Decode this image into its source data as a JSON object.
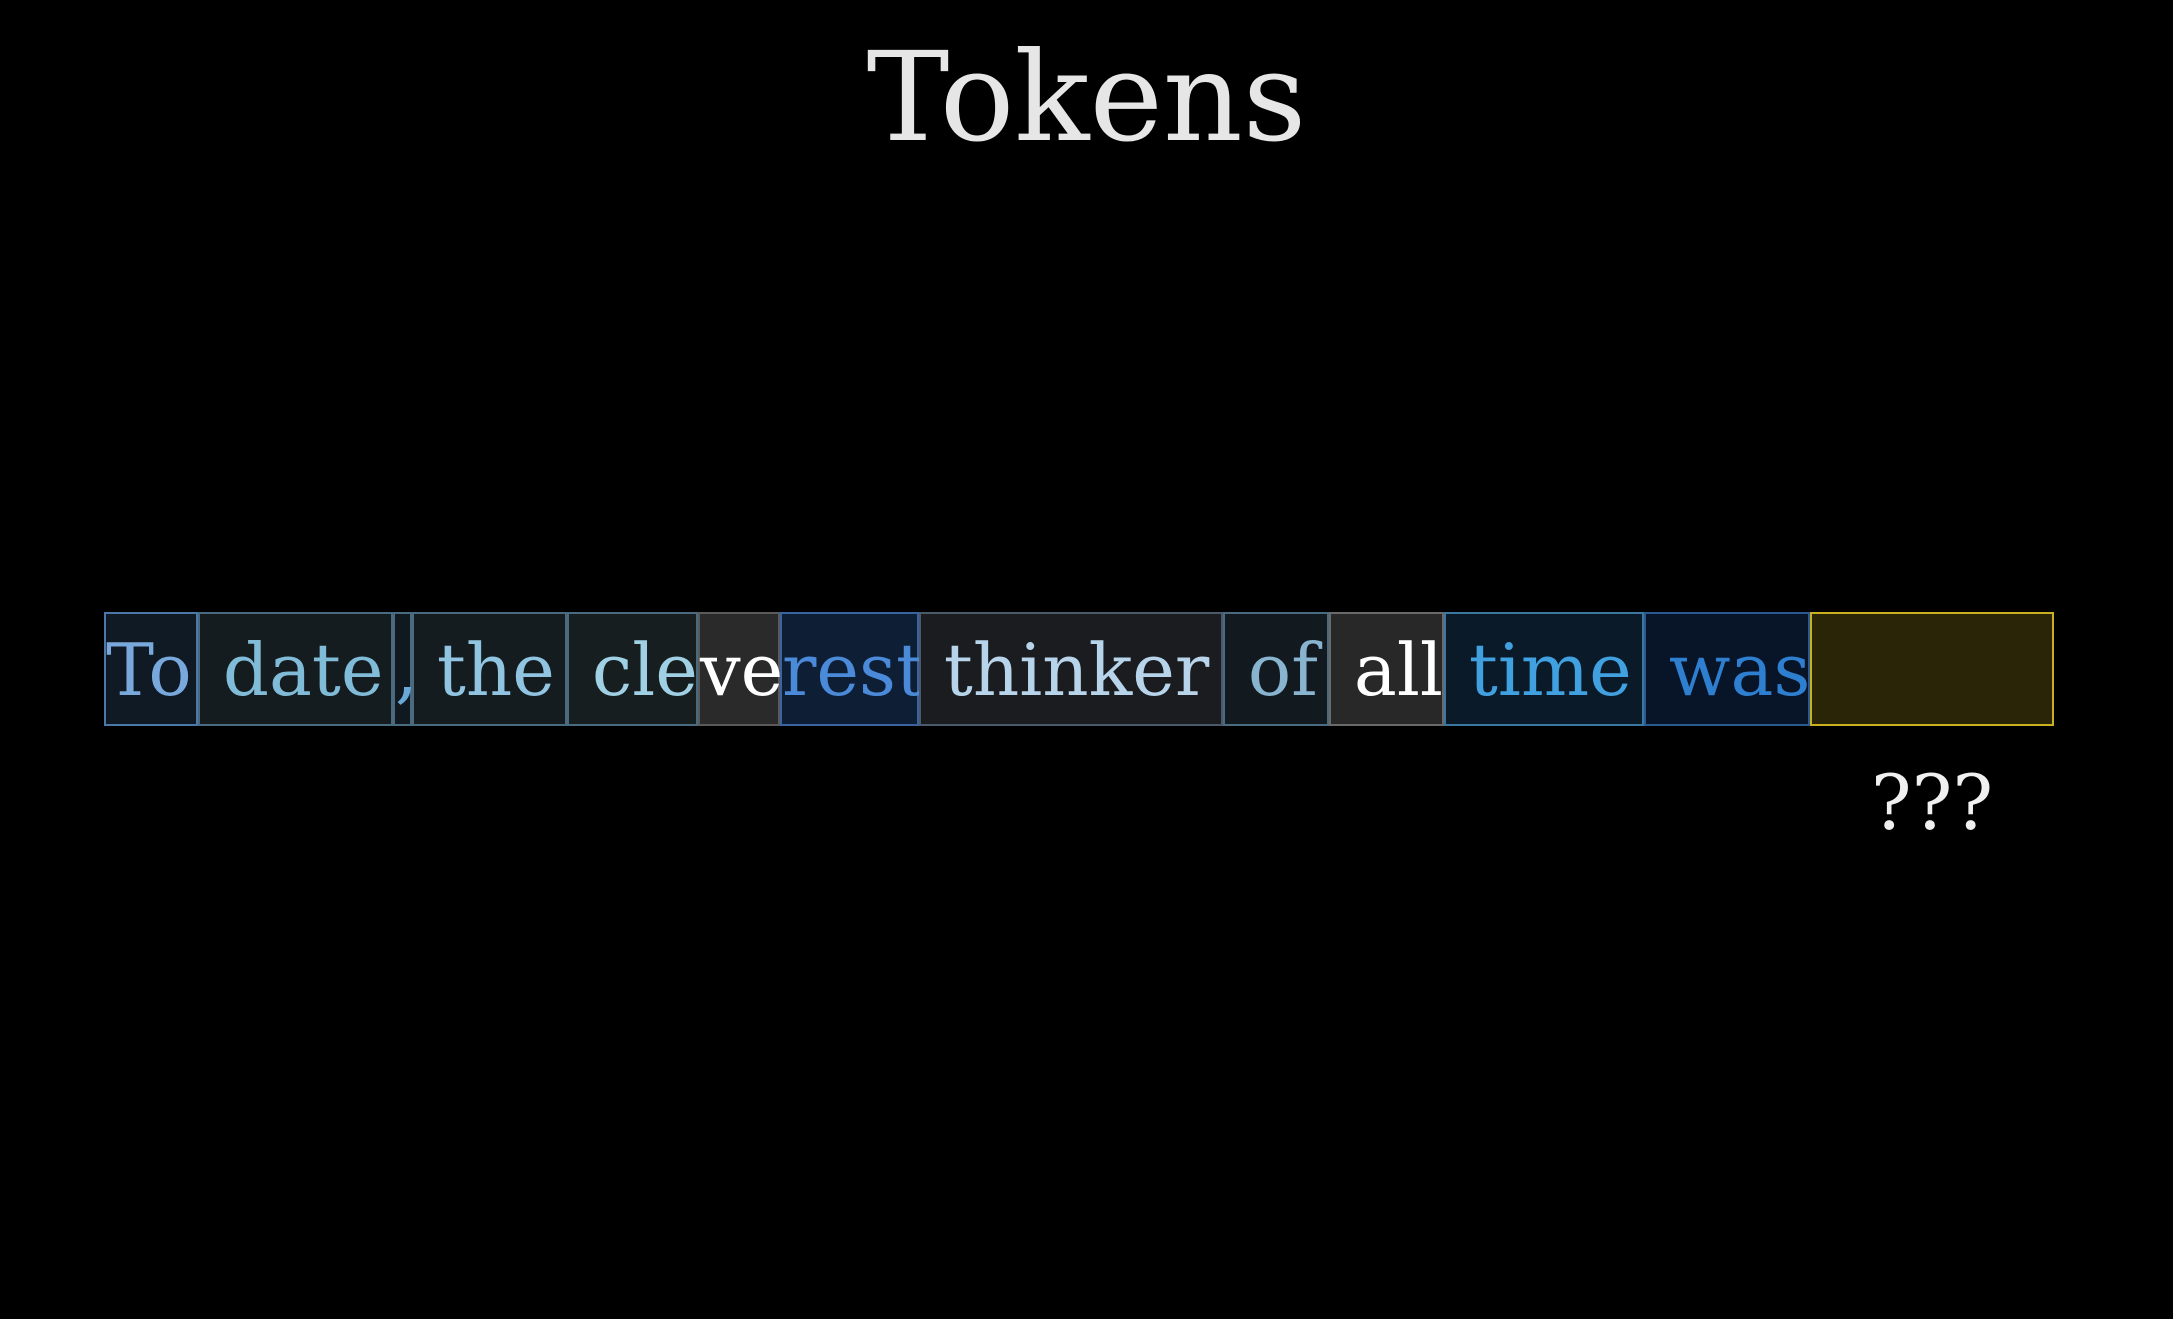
{
  "title": "Tokens",
  "tokens": [
    {
      "text": "To",
      "color": "#78a8dc",
      "fill": "#101a24",
      "border": "#4a78a8"
    },
    {
      "text": " date",
      "color": "#80bcd8",
      "fill": "#141c20",
      "border": "#4a6a80"
    },
    {
      "text": ",",
      "color": "#6aa8d8",
      "fill": "#101820",
      "border": "#4a6a80"
    },
    {
      "text": " the",
      "color": "#90c4e0",
      "fill": "#141c20",
      "border": "#4a6a80"
    },
    {
      "text": " cle",
      "color": "#a0d0e4",
      "fill": "#161e20",
      "border": "#4a6a80"
    },
    {
      "text": "ve",
      "color": "#ffffff",
      "fill": "#2a2a2a",
      "border": "#5a5a5a"
    },
    {
      "text": "rest",
      "color": "#4a8ad8",
      "fill": "#0e1e34",
      "border": "#3a64a0"
    },
    {
      "text": " thinker",
      "color": "#b8d4ea",
      "fill": "#1a1c20",
      "border": "#4a5a6a"
    },
    {
      "text": " of",
      "color": "#88b4d0",
      "fill": "#121a20",
      "border": "#4a6a80"
    },
    {
      "text": " all",
      "color": "#ffffff",
      "fill": "#282828",
      "border": "#6a6a6a"
    },
    {
      "text": " time",
      "color": "#40a0e0",
      "fill": "#0a1a28",
      "border": "#3a78a0"
    },
    {
      "text": " was",
      "color": "#2f7fd0",
      "fill": "#081428",
      "border": "#2a5a90"
    },
    {
      "text": "",
      "color": "#ffffff",
      "fill": "#2b2508",
      "border": "#c8b020"
    }
  ],
  "prediction_label": "???"
}
